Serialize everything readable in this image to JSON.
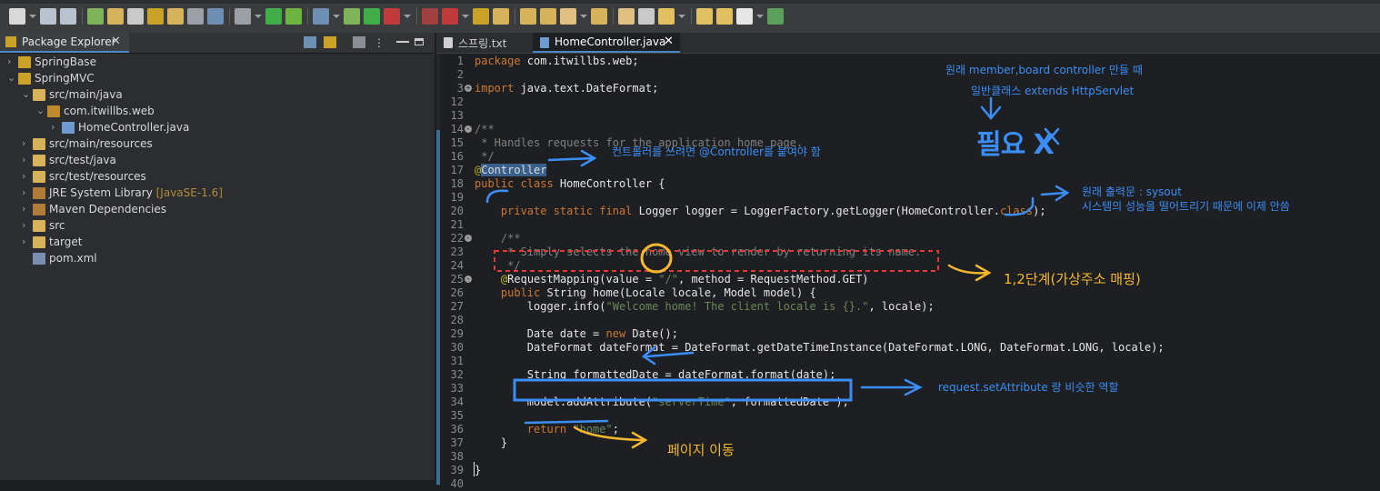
{
  "toolbar": {
    "buttons": [
      "new-icon",
      "save-icon",
      "save-all-icon",
      "spring-icon",
      "pen-icon",
      "team-icon",
      "open-type-icon",
      "open-task-icon",
      "paragraph-icon",
      "console-icon",
      "search-icon",
      "power-icon",
      "spring-leaf-icon",
      "globe-icon",
      "debug-icon",
      "run-icon",
      "run-config-icon",
      "stop-icon",
      "external-tools-icon",
      "new-package-icon",
      "new-class-icon",
      "open-folder-icon",
      "open-project-icon",
      "brush-icon",
      "folder-icon",
      "download-icon",
      "task-icon",
      "prev-edit-icon",
      "next-edit-icon",
      "back-icon",
      "forward-icon",
      "perspective-icon"
    ]
  },
  "explorer": {
    "title": "Package Explorer",
    "items": [
      {
        "label": "SpringBase",
        "depth": 0,
        "twisty": ">",
        "icon": "project-icon"
      },
      {
        "label": "SpringMVC",
        "depth": 0,
        "twisty": "v",
        "icon": "project-icon"
      },
      {
        "label": "src/main/java",
        "depth": 1,
        "twisty": "v",
        "icon": "source-folder-icon"
      },
      {
        "label": "com.itwillbs.web",
        "depth": 2,
        "twisty": "v",
        "icon": "package-icon"
      },
      {
        "label": "HomeController.java",
        "depth": 3,
        "twisty": ">",
        "icon": "java-file-icon"
      },
      {
        "label": "src/main/resources",
        "depth": 1,
        "twisty": ">",
        "icon": "source-folder-icon"
      },
      {
        "label": "src/test/java",
        "depth": 1,
        "twisty": ">",
        "icon": "source-folder-icon"
      },
      {
        "label": "src/test/resources",
        "depth": 1,
        "twisty": ">",
        "icon": "source-folder-icon"
      },
      {
        "label": "JRE System Library",
        "suffix": "[JavaSE-1.6]",
        "depth": 1,
        "twisty": ">",
        "icon": "library-icon"
      },
      {
        "label": "Maven Dependencies",
        "depth": 1,
        "twisty": ">",
        "icon": "library-icon"
      },
      {
        "label": "src",
        "depth": 1,
        "twisty": ">",
        "icon": "folder-icon"
      },
      {
        "label": "target",
        "depth": 1,
        "twisty": ">",
        "icon": "folder-icon"
      },
      {
        "label": "pom.xml",
        "depth": 1,
        "twisty": "",
        "icon": "xml-file-icon"
      }
    ]
  },
  "editor": {
    "tabs": [
      {
        "label": "스프링.txt",
        "active": false
      },
      {
        "label": "HomeController.java",
        "active": true,
        "close": "✕"
      }
    ],
    "lines": [
      {
        "n": "1",
        "tokens": [
          [
            "kw",
            "package "
          ],
          [
            "tx",
            "com.itwillbs.web;"
          ]
        ]
      },
      {
        "n": "2",
        "tokens": []
      },
      {
        "n": "3",
        "fold": "+",
        "tokens": [
          [
            "kw",
            "import "
          ],
          [
            "tx",
            "java.text.DateFormat;"
          ]
        ]
      },
      {
        "n": "12",
        "tokens": []
      },
      {
        "n": "13",
        "tokens": []
      },
      {
        "n": "14",
        "fold": "-",
        "tokens": [
          [
            "cm",
            "/**"
          ]
        ]
      },
      {
        "n": "15",
        "tokens": [
          [
            "cm",
            " * Handles requests for the application home page."
          ]
        ]
      },
      {
        "n": "16",
        "tokens": [
          [
            "cm",
            " */"
          ]
        ]
      },
      {
        "n": "17",
        "tokens": [
          [
            "an",
            "@"
          ],
          [
            "hl",
            "Controller"
          ]
        ]
      },
      {
        "n": "18",
        "tokens": [
          [
            "kw",
            "public class "
          ],
          [
            "tx",
            "HomeController {"
          ]
        ]
      },
      {
        "n": "19",
        "tokens": []
      },
      {
        "n": "20",
        "tokens": [
          [
            "tx",
            "    "
          ],
          [
            "kw",
            "private static final "
          ],
          [
            "tx",
            "Logger logger = LoggerFactory.getLogger(HomeController."
          ],
          [
            "kw",
            "class"
          ],
          [
            "tx",
            ");"
          ]
        ]
      },
      {
        "n": "21",
        "tokens": []
      },
      {
        "n": "22",
        "fold": "-",
        "tokens": [
          [
            "tx",
            "    "
          ],
          [
            "cm",
            "/**"
          ]
        ]
      },
      {
        "n": "23",
        "tokens": [
          [
            "cm",
            "     * Simply selects the home view to render by returning its name."
          ]
        ]
      },
      {
        "n": "24",
        "tokens": [
          [
            "cm",
            "     */"
          ]
        ]
      },
      {
        "n": "25",
        "fold": "-",
        "tokens": [
          [
            "tx",
            "    "
          ],
          [
            "an",
            "@"
          ],
          [
            "tx",
            "RequestMapping(value = "
          ],
          [
            "st",
            "\"/\""
          ],
          [
            "tx",
            ", method = RequestMethod.GET)"
          ]
        ]
      },
      {
        "n": "26",
        "tokens": [
          [
            "tx",
            "    "
          ],
          [
            "kw",
            "public "
          ],
          [
            "tx",
            "String home(Locale locale, Model model) {"
          ]
        ]
      },
      {
        "n": "27",
        "tokens": [
          [
            "tx",
            "        logger.info("
          ],
          [
            "st",
            "\"Welcome home! The client locale is {}.\""
          ],
          [
            "tx",
            ", locale);"
          ]
        ]
      },
      {
        "n": "28",
        "tokens": []
      },
      {
        "n": "29",
        "tokens": [
          [
            "tx",
            "        Date date = "
          ],
          [
            "kw",
            "new "
          ],
          [
            "tx",
            "Date();"
          ]
        ]
      },
      {
        "n": "30",
        "tokens": [
          [
            "tx",
            "        DateFormat dateFormat = DateFormat.getDateTimeInstance(DateFormat.LONG, DateFormat.LONG, locale);"
          ]
        ]
      },
      {
        "n": "31",
        "tokens": []
      },
      {
        "n": "32",
        "tokens": [
          [
            "tx",
            "        String formattedDate = dateFormat.format(date);"
          ]
        ]
      },
      {
        "n": "33",
        "tokens": []
      },
      {
        "n": "34",
        "tokens": [
          [
            "tx",
            "        model.addAttribute("
          ],
          [
            "st",
            "\"serverTime\""
          ],
          [
            "tx",
            ", formattedDate );"
          ]
        ]
      },
      {
        "n": "35",
        "tokens": []
      },
      {
        "n": "36",
        "tokens": [
          [
            "tx",
            "        "
          ],
          [
            "kw",
            "return "
          ],
          [
            "st",
            "\"home\""
          ],
          [
            "tx",
            ";"
          ]
        ]
      },
      {
        "n": "37",
        "tokens": [
          [
            "tx",
            "    }"
          ]
        ]
      },
      {
        "n": "38",
        "tokens": []
      },
      {
        "n": "39",
        "tokens": [
          [
            "tx",
            "}"
          ]
        ]
      },
      {
        "n": "40",
        "tokens": []
      }
    ]
  },
  "annotations": {
    "servlet_line1": "원래 member,board controller 만들 때",
    "servlet_line2": "일반클래스 extends HttpServlet",
    "needed_no": "필요 X",
    "controller_note": "컨트롤러를 쓰려면 @Controller를 붙여야 함",
    "sysout_line1": "원래 출력문 : sysout",
    "sysout_line2": "시스템의 성능을 떨어트리기 때문에 이제 안씀",
    "mapping_note": "1,2단계(가상주소 매핑)",
    "request_note": "request.setAttribute 랑 비슷한 역할",
    "page_move": "페이지 이동",
    "colors": {
      "blue": "#3b8ef6",
      "orange": "#f5b82e",
      "red": "#e53935"
    }
  }
}
